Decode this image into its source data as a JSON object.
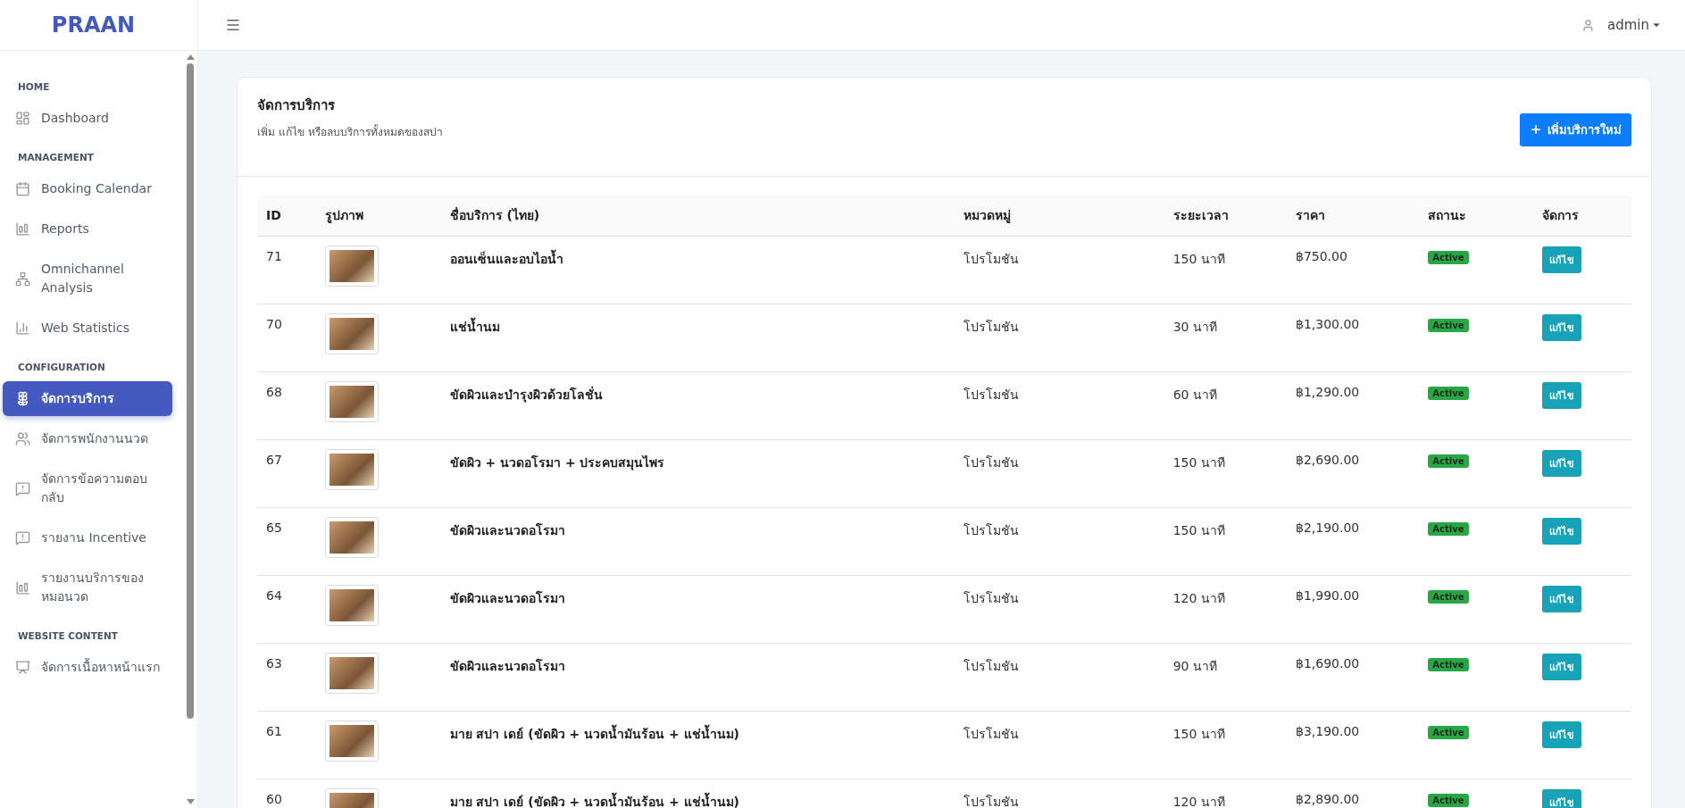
{
  "sidebar": {
    "logo": "PRAAN",
    "sections": [
      {
        "title": "HOME",
        "items": [
          {
            "label": "Dashboard",
            "selected": false
          }
        ]
      },
      {
        "title": "MANAGEMENT",
        "items": [
          {
            "label": "Booking Calendar",
            "selected": false
          },
          {
            "label": "Reports",
            "selected": false
          },
          {
            "label": "Omnichannel Analysis",
            "selected": false
          },
          {
            "label": "Web Statistics",
            "selected": false
          }
        ]
      },
      {
        "title": "CONFIGURATION",
        "items": [
          {
            "label": "จัดการบริการ",
            "selected": true
          },
          {
            "label": "จัดการพนักงานนวด",
            "selected": false
          },
          {
            "label": "จัดการข้อความตอบกลับ",
            "selected": false
          },
          {
            "label": "รายงาน Incentive",
            "selected": false
          },
          {
            "label": "รายงานบริการของหมอนวด",
            "selected": false
          }
        ]
      },
      {
        "title": "WEBSITE CONTENT",
        "items": [
          {
            "label": "จัดการเนื้อหาหน้าแรก",
            "selected": false
          }
        ]
      }
    ]
  },
  "header": {
    "user": "admin"
  },
  "card": {
    "title": "จัดการบริการ",
    "subtitle": "เพิ่ม แก้ไข หรือลบบริการทั้งหมดของสปา",
    "add_button": "เพิ่มบริการใหม่"
  },
  "table": {
    "columns": [
      "ID",
      "รูปภาพ",
      "ชื่อบริการ (ไทย)",
      "หมวดหมู่",
      "ระยะเวลา",
      "ราคา",
      "สถานะ",
      "จัดการ"
    ],
    "rows": [
      {
        "id": "71",
        "name": "ออนเซ็นและอบไอน้ำ",
        "category": "โปรโมชัน",
        "duration": "150 นาที",
        "price": "฿750.00",
        "status": "Active",
        "action": "แก้ไข"
      },
      {
        "id": "70",
        "name": "แช่น้ำนม",
        "category": "โปรโมชัน",
        "duration": "30 นาที",
        "price": "฿1,300.00",
        "status": "Active",
        "action": "แก้ไข"
      },
      {
        "id": "68",
        "name": "ขัดผิวและบำรุงผิวด้วยโลชั่น",
        "category": "โปรโมชัน",
        "duration": "60 นาที",
        "price": "฿1,290.00",
        "status": "Active",
        "action": "แก้ไข"
      },
      {
        "id": "67",
        "name": "ขัดผิว + นวดอโรมา + ประคบสมุนไพร",
        "category": "โปรโมชัน",
        "duration": "150 นาที",
        "price": "฿2,690.00",
        "status": "Active",
        "action": "แก้ไข"
      },
      {
        "id": "65",
        "name": "ขัดผิวและนวดอโรมา",
        "category": "โปรโมชัน",
        "duration": "150 นาที",
        "price": "฿2,190.00",
        "status": "Active",
        "action": "แก้ไข"
      },
      {
        "id": "64",
        "name": "ขัดผิวและนวดอโรมา",
        "category": "โปรโมชัน",
        "duration": "120 นาที",
        "price": "฿1,990.00",
        "status": "Active",
        "action": "แก้ไข"
      },
      {
        "id": "63",
        "name": "ขัดผิวและนวดอโรมา",
        "category": "โปรโมชัน",
        "duration": "90 นาที",
        "price": "฿1,690.00",
        "status": "Active",
        "action": "แก้ไข"
      },
      {
        "id": "61",
        "name": "มาย สปา เดย์ (ขัดผิว + นวดน้ำมันร้อน + แช่น้ำนม)",
        "category": "โปรโมชัน",
        "duration": "150 นาที",
        "price": "฿3,190.00",
        "status": "Active",
        "action": "แก้ไข"
      },
      {
        "id": "60",
        "name": "มาย สปา เดย์ (ขัดผิว + นวดน้ำมันร้อน + แช่น้ำนม)",
        "category": "โปรโมชัน",
        "duration": "120 นาที",
        "price": "฿2,890.00",
        "status": "Active",
        "action": "แก้ไข"
      }
    ]
  }
}
